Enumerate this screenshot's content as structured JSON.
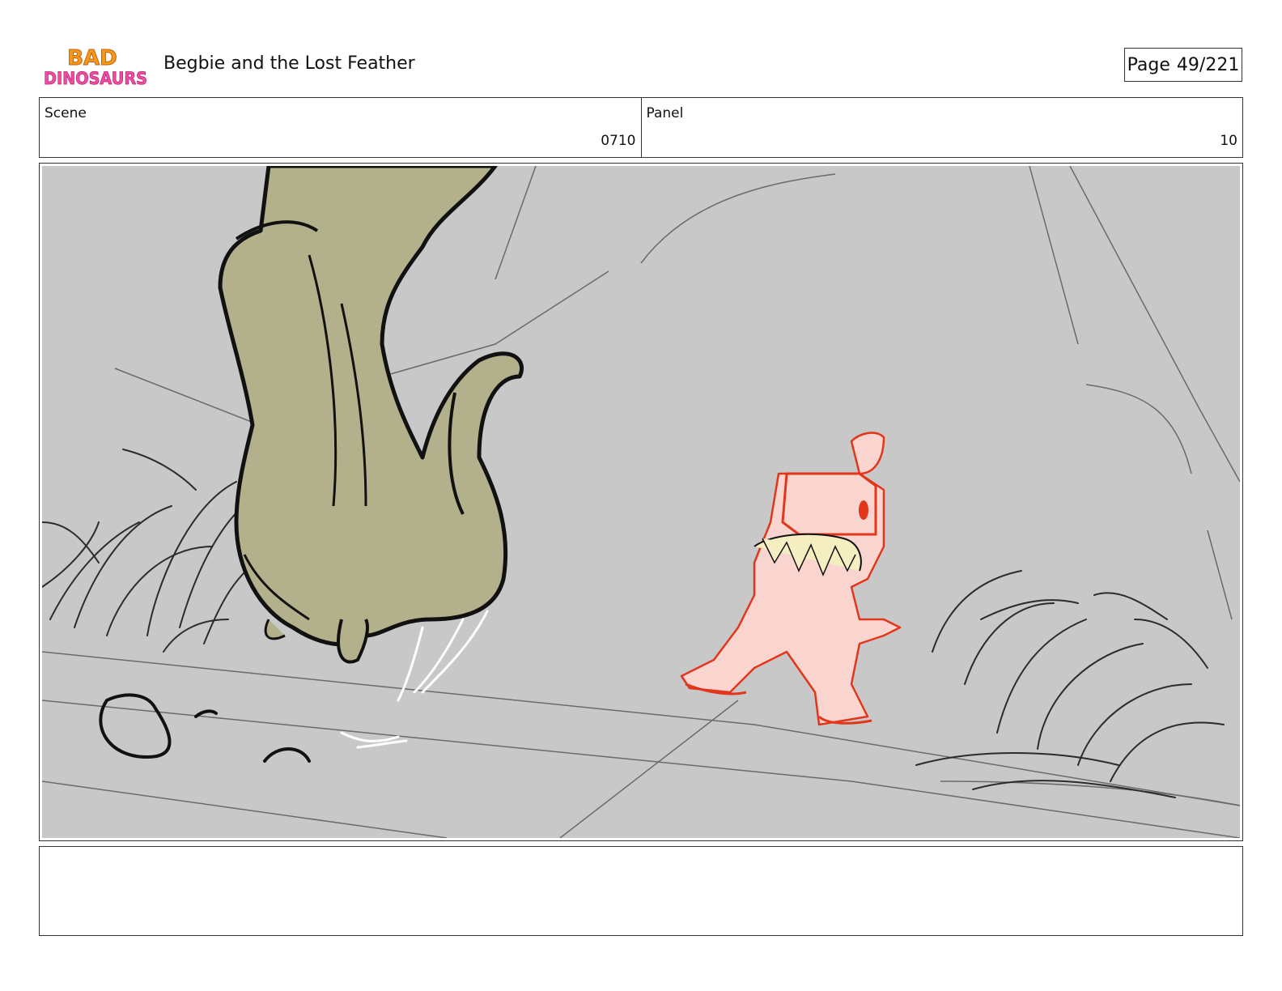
{
  "header": {
    "logo_line1": "BAD",
    "logo_line2": "DINOSAURS",
    "title": "Begbie and the Lost Feather",
    "page_label": "Page",
    "page_number": "49/221"
  },
  "info": {
    "scene_label": "Scene",
    "scene_value": "0710",
    "panel_label": "Panel",
    "panel_value": "10"
  },
  "colors": {
    "background": "#c8c8c8",
    "dinosaur_skin": "#b3b08c",
    "pink_character": "#fad4cf",
    "pink_outline": "#e2361b",
    "teeth": "#f4eec0"
  },
  "notes": {
    "text": ""
  }
}
